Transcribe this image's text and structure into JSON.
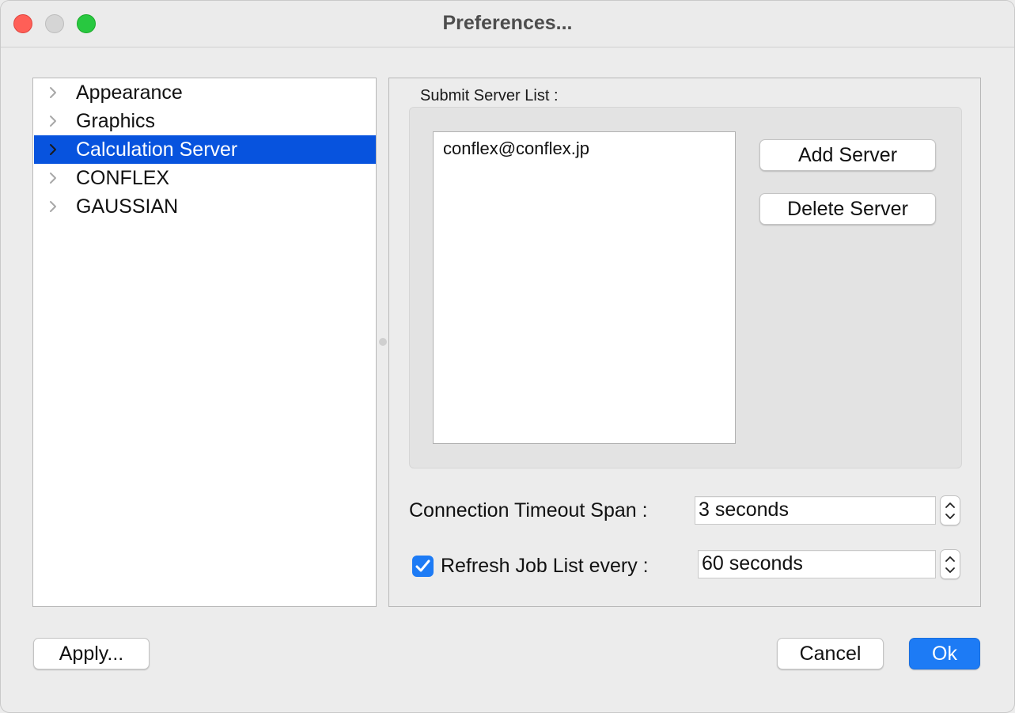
{
  "window": {
    "title": "Preferences..."
  },
  "sidebar": {
    "items": [
      {
        "label": "Appearance",
        "selected": false
      },
      {
        "label": "Graphics",
        "selected": false
      },
      {
        "label": "Calculation Server",
        "selected": true
      },
      {
        "label": "CONFLEX",
        "selected": false
      },
      {
        "label": "GAUSSIAN",
        "selected": false
      }
    ]
  },
  "server_panel": {
    "group_title": "Submit Server List :",
    "servers": [
      "conflex@conflex.jp"
    ],
    "add_label": "Add Server",
    "delete_label": "Delete Server"
  },
  "settings": {
    "timeout_label": "Connection Timeout Span :",
    "timeout_value": "3 seconds",
    "refresh_label": "Refresh Job List every :",
    "refresh_value": "60 seconds",
    "refresh_checked": true
  },
  "footer": {
    "apply_label": "Apply...",
    "cancel_label": "Cancel",
    "ok_label": "Ok"
  },
  "colors": {
    "selection": "#0753de",
    "accent": "#1d7bf5"
  },
  "icons": [
    "chevron-right-icon",
    "chevron-up-icon",
    "chevron-down-icon",
    "checkmark-icon"
  ]
}
